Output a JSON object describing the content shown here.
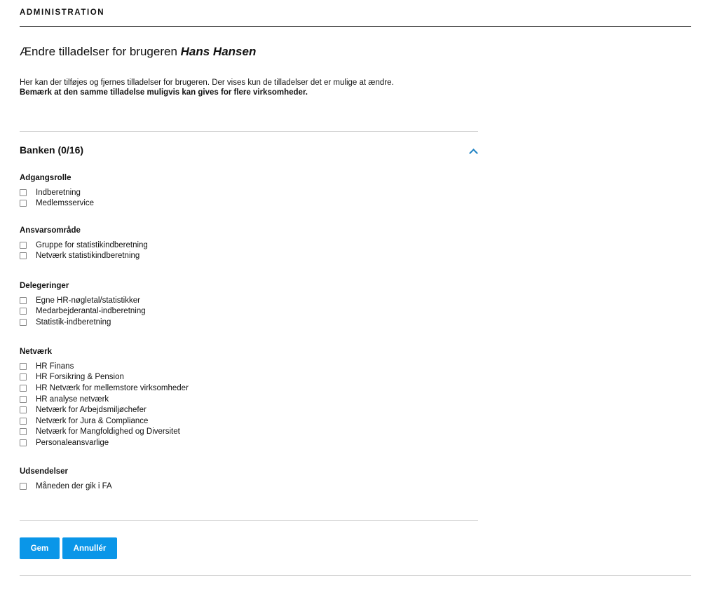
{
  "header": {
    "label": "ADMINISTRATION"
  },
  "page": {
    "title_prefix": "Ændre tilladelser for brugeren ",
    "user_name": "Hans Hansen",
    "intro_line1": "Her kan der tilføjes og fjernes tilladelser for brugeren. Der vises kun de tilladelser det er mulige at ændre.",
    "intro_line2": "Bemærk at den samme tilladelse muligvis kan gives for flere virksomheder."
  },
  "section": {
    "title": "Banken (0/16)",
    "expanded": true,
    "accent_color": "#1a7fc2"
  },
  "groups": [
    {
      "title": "Adgangsrolle",
      "options": [
        {
          "label": "Indberetning",
          "checked": false
        },
        {
          "label": "Medlemsservice",
          "checked": false
        }
      ]
    },
    {
      "title": "Ansvarsområde",
      "options": [
        {
          "label": "Gruppe for statistikindberetning",
          "checked": false
        },
        {
          "label": "Netværk statistikindberetning",
          "checked": false
        }
      ]
    },
    {
      "title": "Delegeringer",
      "options": [
        {
          "label": "Egne HR-nøgletal/statistikker",
          "checked": false
        },
        {
          "label": "Medarbejderantal-indberetning",
          "checked": false
        },
        {
          "label": "Statistik-indberetning",
          "checked": false
        }
      ]
    },
    {
      "title": "Netværk",
      "options": [
        {
          "label": "HR Finans",
          "checked": false
        },
        {
          "label": "HR Forsikring & Pension",
          "checked": false
        },
        {
          "label": "HR Netværk for mellemstore virksomheder",
          "checked": false
        },
        {
          "label": "HR analyse netværk",
          "checked": false
        },
        {
          "label": "Netværk for Arbejdsmiljøchefer",
          "checked": false
        },
        {
          "label": "Netværk for Jura & Compliance",
          "checked": false
        },
        {
          "label": "Netværk for Mangfoldighed og Diversitet",
          "checked": false
        },
        {
          "label": "Personaleansvarlige",
          "checked": false
        }
      ]
    },
    {
      "title": "Udsendelser",
      "options": [
        {
          "label": "Måneden der gik i FA",
          "checked": false
        }
      ]
    }
  ],
  "actions": {
    "save_label": "Gem",
    "cancel_label": "Annullér",
    "button_color": "#0a96e8"
  }
}
